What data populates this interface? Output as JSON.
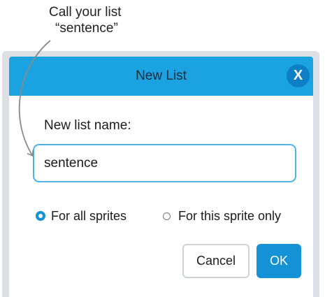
{
  "annotation": {
    "line1": "Call your list",
    "line2": "“sentence”"
  },
  "dialog": {
    "title": "New List",
    "close_icon": "close-icon",
    "close_glyph": "X",
    "field_label": "New list name:",
    "name_value": "sentence",
    "radio_options": [
      {
        "label": "For all sprites",
        "selected": true
      },
      {
        "label": "For this sprite only",
        "selected": false
      }
    ],
    "cancel_label": "Cancel",
    "ok_label": "OK"
  },
  "colors": {
    "titlebar": "#1aa3e0",
    "accent": "#1592d6",
    "frame": "#dcdfe3"
  }
}
